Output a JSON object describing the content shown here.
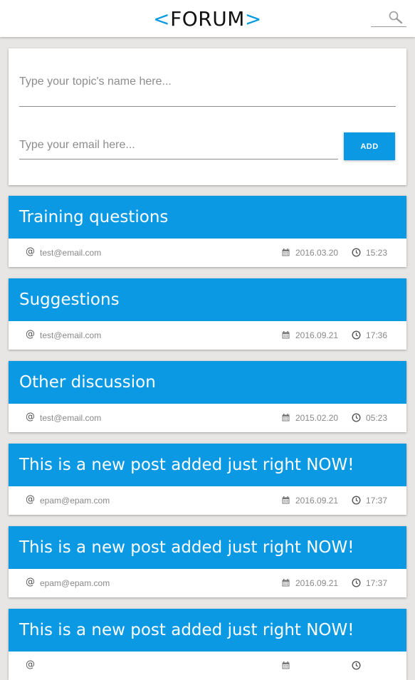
{
  "header": {
    "logo_left": "<",
    "logo_text": "FORUM",
    "logo_right": ">"
  },
  "form": {
    "topic_placeholder": "Type your topic's name here...",
    "email_placeholder": "Type your email here...",
    "add_label": "ADD"
  },
  "posts": [
    {
      "title": "Training questions",
      "author": "test@email.com",
      "date": "2016.03.20",
      "time": "15:23"
    },
    {
      "title": "Suggestions",
      "author": "test@email.com",
      "date": "2016.09.21",
      "time": "17:36"
    },
    {
      "title": "Other discussion",
      "author": "test@email.com",
      "date": "2015.02.20",
      "time": "05:23"
    },
    {
      "title": "This is a new post added just right NOW!",
      "author": "epam@epam.com",
      "date": "2016.09.21",
      "time": "17:37"
    },
    {
      "title": "This is a new post added just right NOW!",
      "author": "epam@epam.com",
      "date": "2016.09.21",
      "time": "17:37"
    },
    {
      "title": "This is a new post added just right NOW!",
      "author": "",
      "date": "",
      "time": ""
    }
  ],
  "colors": {
    "accent": "#0a99e2",
    "background": "#e8e6e4"
  },
  "icons": {
    "at": "@",
    "search": "search-icon",
    "calendar": "calendar-icon",
    "clock": "clock-icon"
  }
}
